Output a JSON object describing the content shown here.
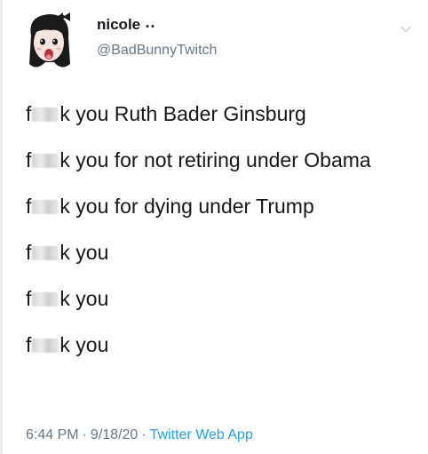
{
  "user": {
    "display_name": "nicole",
    "emoji": "••",
    "handle": "@BadBunnyTwitch"
  },
  "tweet": {
    "lines": [
      {
        "prefix": "f",
        "suffix": "k you Ruth Bader Ginsburg"
      },
      {
        "prefix": "f",
        "suffix": "k you for not retiring under Obama"
      },
      {
        "prefix": "f",
        "suffix": "k you for dying under Trump"
      },
      {
        "prefix": "f",
        "suffix": "k you"
      },
      {
        "prefix": "f",
        "suffix": "k you"
      },
      {
        "prefix": "f",
        "suffix": "k you"
      }
    ]
  },
  "meta": {
    "time": "6:44 PM",
    "sep1": "·",
    "date": "9/18/20",
    "sep2": "·",
    "source": "Twitter Web App"
  },
  "colors": {
    "text": "#14171a",
    "secondary": "#657786",
    "link": "#1da1f2"
  },
  "icons": {
    "avatar": "cartoon-girl-avatar",
    "menu": "chevron-down-icon"
  }
}
